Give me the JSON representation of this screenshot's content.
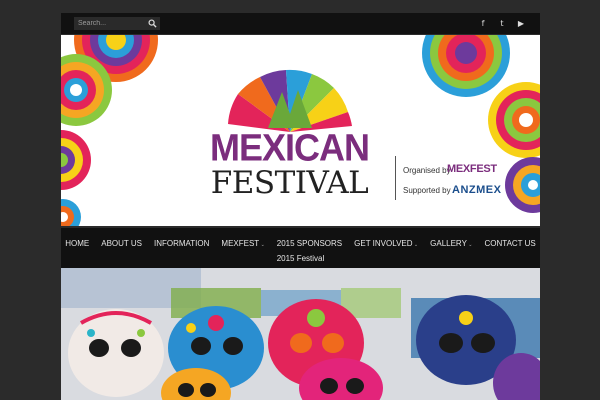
{
  "search": {
    "placeholder": "Search..."
  },
  "social": [
    {
      "icon": "facebook-icon",
      "glyph": "f"
    },
    {
      "icon": "twitter-icon",
      "glyph": "t"
    },
    {
      "icon": "youtube-icon",
      "glyph": "▶"
    }
  ],
  "banner": {
    "title_line1": "MEXICAN",
    "title_line2": "FESTIVAL",
    "organised_label": "Organised by",
    "organiser": "MEXFEST",
    "supported_label": "Supported by",
    "supporter": "ANZMEX",
    "colors": {
      "purple": "#7b2d7d",
      "blue": "#1b4e8c"
    }
  },
  "nav": {
    "items": [
      {
        "label": "HOME"
      },
      {
        "label": "ABOUT US"
      },
      {
        "label": "INFORMATION"
      },
      {
        "label": "MEXFEST",
        "dropdown": true
      },
      {
        "label": "2015 SPONSORS"
      },
      {
        "label": "GET INVOLVED",
        "dropdown": true
      },
      {
        "label": "GALLERY",
        "dropdown": true
      },
      {
        "label": "CONTACT US"
      }
    ],
    "row2_label": "2015 Festival"
  }
}
